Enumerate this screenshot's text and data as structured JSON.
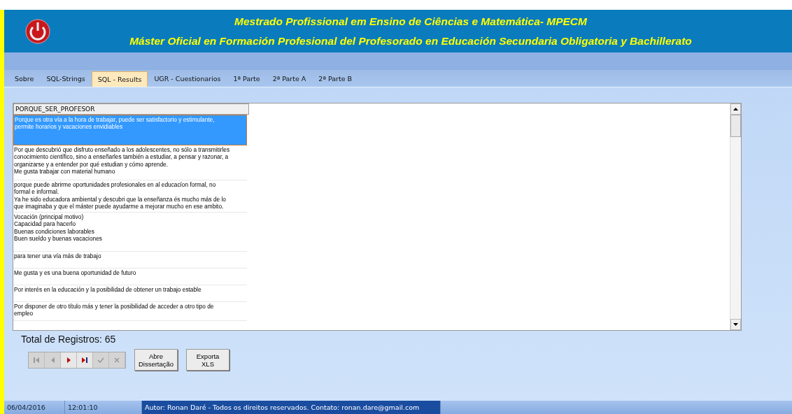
{
  "header": {
    "titles": [
      "Mestrado Profissional em Ensino de Ciências e Matemática- MPECM",
      "Máster Oficial en Formación Profesional del Profesorado en Educación Secundaria Obligatoria y Bachillerato"
    ]
  },
  "tabs": [
    {
      "label": "Sobre",
      "selected": false
    },
    {
      "label": "SQL-Strings",
      "selected": false
    },
    {
      "label": "SQL - Results",
      "selected": true
    },
    {
      "label": "UGR - Cuestionarios",
      "selected": false
    },
    {
      "label": "1ª Parte",
      "selected": false
    },
    {
      "label": "2ª Parte A",
      "selected": false
    },
    {
      "label": "2ª Parte B",
      "selected": false
    }
  ],
  "table": {
    "columns": [
      "PORQUE_SER_PROFESOR"
    ],
    "rows": [
      {
        "text": "Porque es otra vía a la hora de trabajar, puede ser satisfactorio y estimulante,\npermite horarios y vacaciones envidiables",
        "selected": true
      },
      {
        "text": "Por que descubrió que disfruto enseñado a los adolescentes, no sólo a transmitirles\nconocimiento científico, sino a enseñarles también a estudiar, a pensar y razonar, a\norganizarse y a entender por qué estudian y cómo aprende.\nMe gusta trabajar con material humano",
        "selected": false
      },
      {
        "text": "porque puede abrirme oportunidades profesionales en al educacíon formal, no\nformal e informal.\nYa he sido educadora ambiental y descubri que la enseñanza és mucho más de lo\nque imaginaba y que el máster puede ayudarme a mejorar mucho en ese ambito.",
        "selected": false
      },
      {
        "text": "Vocación (principal motivo)\nCapacidad para hacerlo\nBuenas condiciones laborables\nBuen sueldo y buenas vacaciones",
        "selected": false
      },
      {
        "text": "para tener una vía más de trabajo",
        "selected": false
      },
      {
        "text": "Me gusta y es una buena oportunidad de futuro",
        "selected": false
      },
      {
        "text": "Por interés en la educación y la posibilidad de obtener un trabajo estable",
        "selected": false
      },
      {
        "text": "Por disponer de otro título más y tener la posibilidad de acceder a otro tipo de\nempleo",
        "selected": false
      }
    ]
  },
  "total": "Total de Registros: 65",
  "navigator": [
    {
      "kind": "first",
      "disabled": true
    },
    {
      "kind": "prev",
      "disabled": true
    },
    {
      "kind": "next",
      "disabled": false
    },
    {
      "kind": "last",
      "disabled": false
    },
    {
      "kind": "post",
      "disabled": true
    },
    {
      "kind": "cancel",
      "disabled": true
    }
  ],
  "buttons": [
    "Abre\nDissertação",
    "Exporta\nXLS"
  ],
  "status_bar": [
    "06/04/2016",
    "12:01:10",
    "Autor: Ronan Daré - Todos os direitos reservados. Contato: ronan.dare@gmail.com"
  ]
}
